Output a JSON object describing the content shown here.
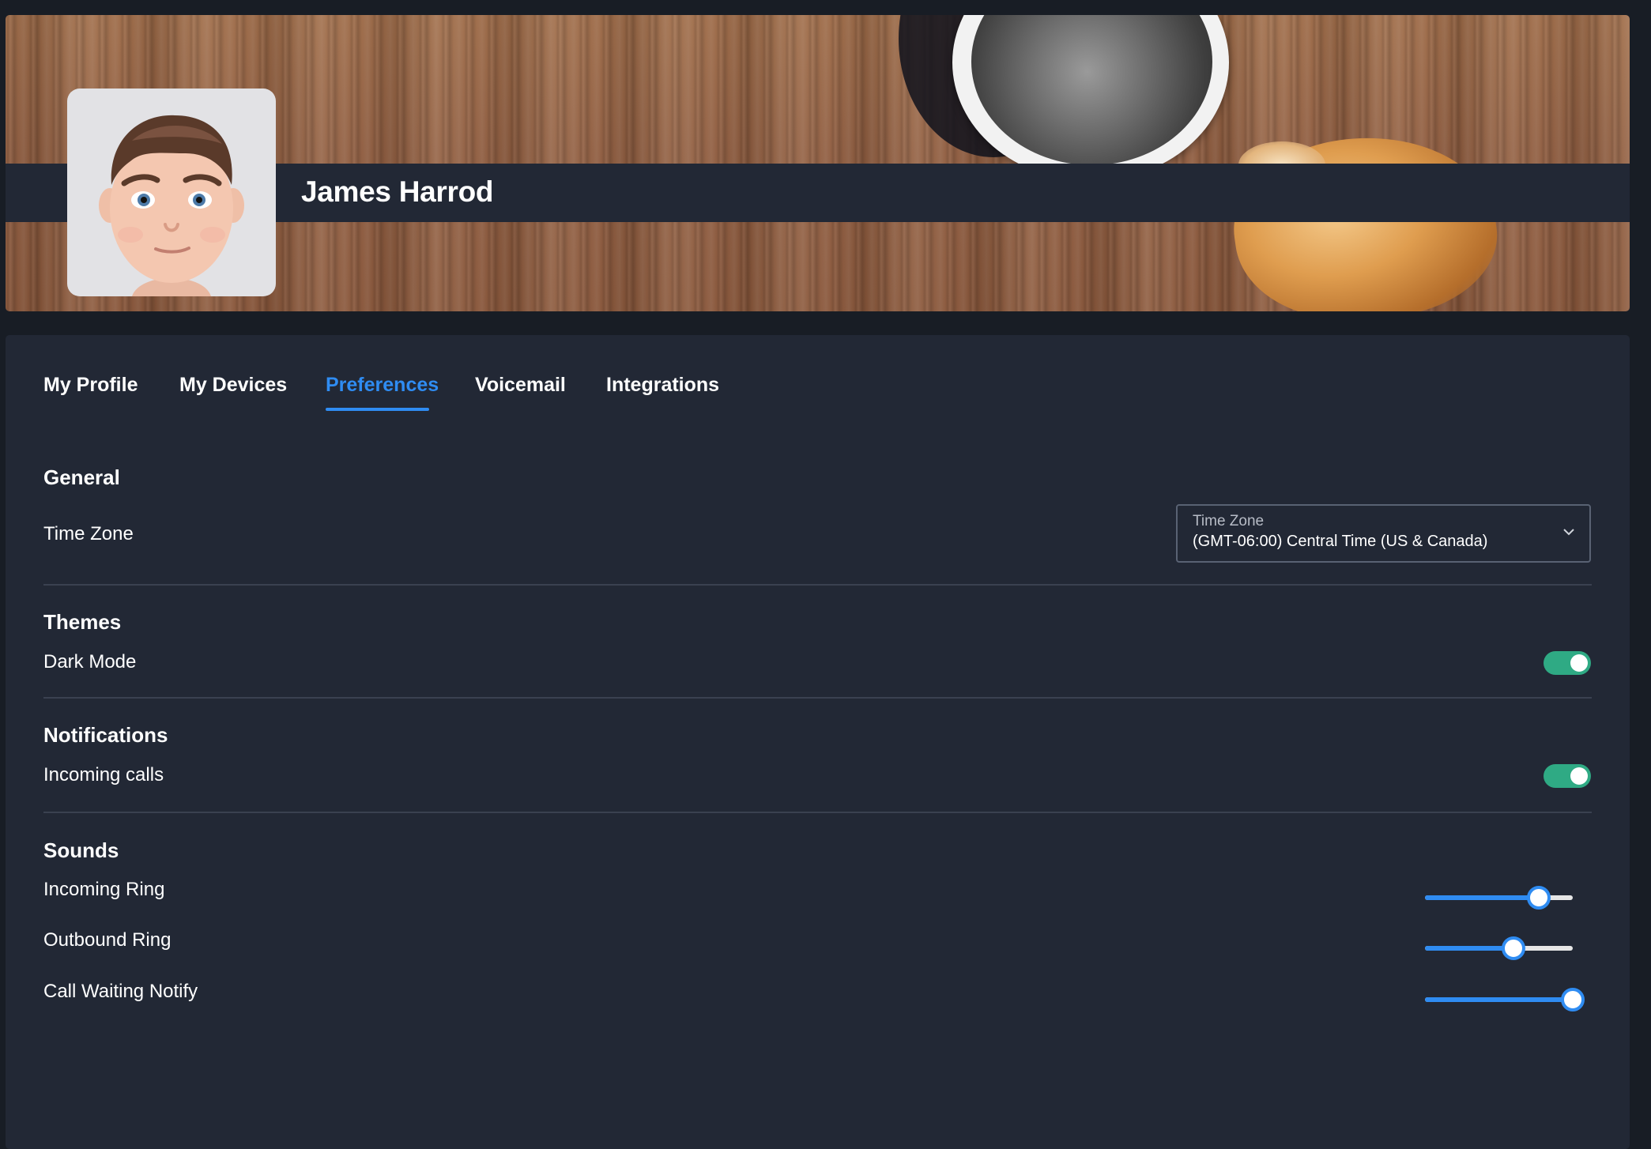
{
  "profile": {
    "name": "James Harrod"
  },
  "tabs": [
    {
      "label": "My Profile",
      "active": false
    },
    {
      "label": "My Devices",
      "active": false
    },
    {
      "label": "Preferences",
      "active": true
    },
    {
      "label": "Voicemail",
      "active": false
    },
    {
      "label": "Integrations",
      "active": false
    }
  ],
  "sections": {
    "general": {
      "title": "General",
      "time_zone_label": "Time Zone",
      "time_zone_select": {
        "label": "Time Zone",
        "value": "(GMT-06:00) Central Time (US & Canada)"
      }
    },
    "themes": {
      "title": "Themes",
      "dark_mode_label": "Dark Mode",
      "dark_mode_on": true
    },
    "notifications": {
      "title": "Notifications",
      "incoming_calls_label": "Incoming calls",
      "incoming_calls_on": true
    },
    "sounds": {
      "title": "Sounds",
      "sliders": [
        {
          "label": "Incoming Ring",
          "level": 0.77
        },
        {
          "label": "Outbound Ring",
          "level": 0.6
        },
        {
          "label": "Call Waiting Notify",
          "level": 1.0
        }
      ]
    }
  },
  "colors": {
    "accent": "#2f8cf2",
    "toggle_on": "#2faa84",
    "panel_bg": "#222835",
    "page_bg": "#181d25"
  }
}
